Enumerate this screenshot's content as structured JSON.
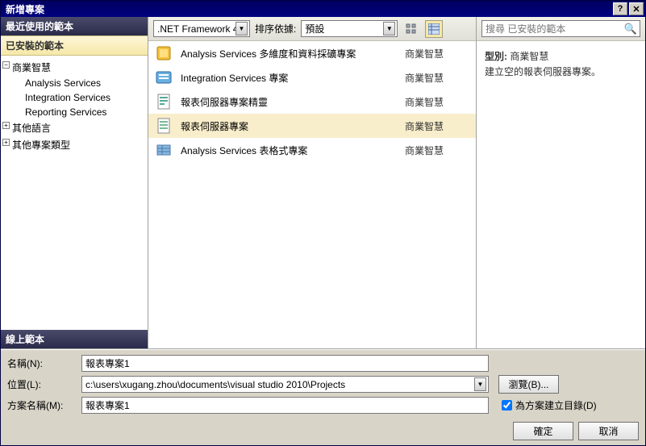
{
  "title": "新增專案",
  "left": {
    "recent_header": "最近使用的範本",
    "installed_header": "已安裝的範本",
    "online_header": "線上範本",
    "tree": {
      "bi": "商業智慧",
      "bi_children": [
        "Analysis Services",
        "Integration Services",
        "Reporting Services"
      ],
      "other_lang": "其他語言",
      "other_type": "其他專案類型"
    }
  },
  "toolbar": {
    "framework": ".NET Framework 4",
    "sort_label": "排序依據:",
    "sort_value": "預設"
  },
  "templates": [
    {
      "name": "Analysis Services 多維度和資料採礦專案",
      "category": "商業智慧"
    },
    {
      "name": "Integration Services 專案",
      "category": "商業智慧"
    },
    {
      "name": "報表伺服器專案精靈",
      "category": "商業智慧"
    },
    {
      "name": "報表伺服器專案",
      "category": "商業智慧"
    },
    {
      "name": "Analysis Services 表格式專案",
      "category": "商業智慧"
    }
  ],
  "selected_template_index": 3,
  "search": {
    "placeholder": "搜尋 已安裝的範本"
  },
  "desc": {
    "type_label": "型別:",
    "type_value": "商業智慧",
    "text": "建立空的報表伺服器專案。"
  },
  "form": {
    "name_label": "名稱(N):",
    "name_value": "報表專案1",
    "location_label": "位置(L):",
    "location_value": "c:\\users\\xugang.zhou\\documents\\visual studio 2010\\Projects",
    "solution_name_label": "方案名稱(M):",
    "solution_name_value": "報表專案1",
    "browse_label": "瀏覽(B)...",
    "create_dir_label": "為方案建立目錄(D)",
    "create_dir_checked": true
  },
  "buttons": {
    "ok": "確定",
    "cancel": "取消"
  }
}
